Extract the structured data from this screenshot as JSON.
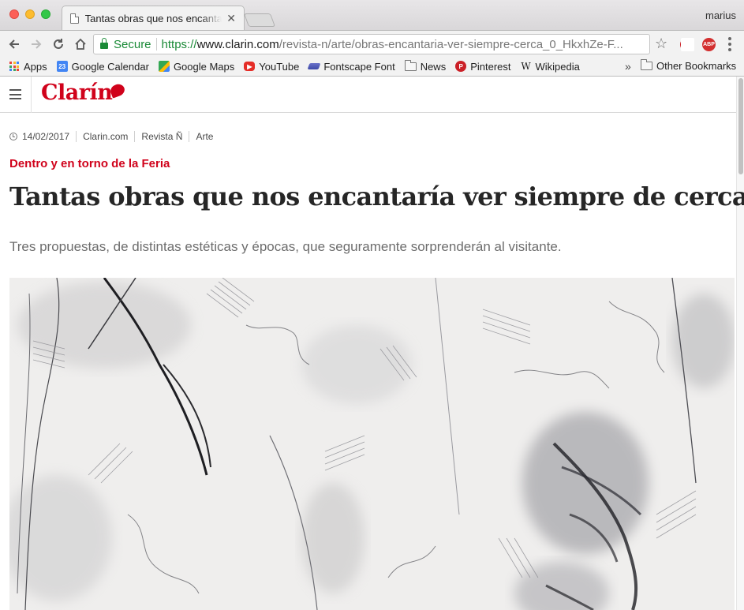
{
  "browser": {
    "tab_title": "Tantas obras que nos encantaría ver siempre de cerca",
    "tab_close": "✕",
    "profile_name": "marius",
    "security_label": "Secure",
    "url_scheme": "https://",
    "url_host": "www.clarin.com",
    "url_path": "/revista-n/arte/obras-encantaria-ver-siempre-cerca_0_HkxhZe-F...",
    "icons": [
      "back-arrow-icon",
      "forward-arrow-icon",
      "reload-icon",
      "home-icon",
      "lock-icon",
      "star-icon",
      "pinterest-icon",
      "b-extension-icon",
      "adblock-icon",
      "menu-icon"
    ]
  },
  "bookmarks": {
    "items": [
      {
        "label": "Apps",
        "icon": "apps-grid-icon"
      },
      {
        "label": "Google Calendar",
        "icon": "calendar-icon",
        "icon_text": "23"
      },
      {
        "label": "Google Maps",
        "icon": "maps-icon"
      },
      {
        "label": "YouTube",
        "icon": "youtube-icon"
      },
      {
        "label": "Fontscape Font",
        "icon": "fontscape-icon"
      },
      {
        "label": "News",
        "icon": "folder-icon"
      },
      {
        "label": "Pinterest",
        "icon": "pinterest-icon"
      },
      {
        "label": "Wikipedia",
        "icon": "wikipedia-icon",
        "icon_text": "W"
      }
    ],
    "overflow": "»",
    "other": "Other Bookmarks"
  },
  "site": {
    "logo_text": "Clarín",
    "brand_color": "#d0021b"
  },
  "article": {
    "date": "14/02/2017",
    "meta_links": [
      "Clarin.com",
      "Revista Ñ",
      "Arte"
    ],
    "kicker": "Dentro y en torno de la Feria",
    "headline": "Tantas obras que nos encantaría ver siempre de cerca",
    "dek": "Tres propuestas, de distintas estéticas y épocas, que seguramente sorprenderán  al visitante."
  }
}
